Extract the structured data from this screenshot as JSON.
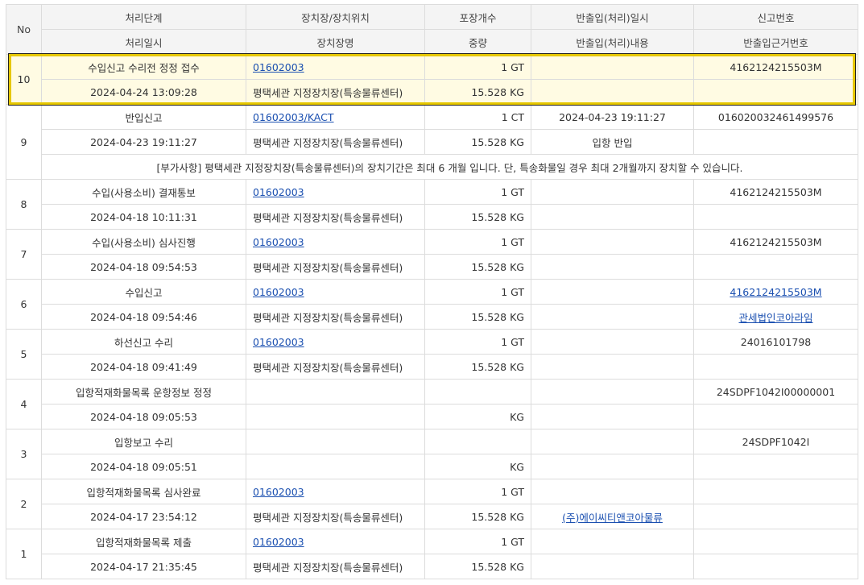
{
  "header": {
    "no": "No",
    "top": [
      "처리단계",
      "장치장/장치위치",
      "포장개수",
      "반출입(처리)일시",
      "신고번호"
    ],
    "bottom": [
      "처리일시",
      "장치장명",
      "중량",
      "반출입(처리)내용",
      "반출입근거번호"
    ]
  },
  "rows": [
    {
      "no": "10",
      "stage": "수입신고 수리전 정정 접수",
      "location": "01602003",
      "count": "1 GT",
      "io_time": "",
      "decl_no": "4162124215503M",
      "time": "2024-04-24 13:09:28",
      "place_name": "평택세관 지정장치장(특송물류센터)",
      "weight": "15.528 KG",
      "io_content": "",
      "basis_no": ""
    },
    {
      "no": "9",
      "stage": "반입신고",
      "location": "01602003/KACT",
      "count": "1 CT",
      "io_time": "2024-04-23 19:11:27",
      "decl_no": "016020032461499576",
      "time": "2024-04-23 19:11:27",
      "place_name": "평택세관 지정장치장(특송물류센터)",
      "weight": "15.528 KG",
      "io_content": "입항 반입",
      "basis_no": ""
    },
    {
      "no": "8",
      "stage": "수입(사용소비) 결재통보",
      "location": "01602003",
      "count": "1 GT",
      "io_time": "",
      "decl_no": "4162124215503M",
      "time": "2024-04-18 10:11:31",
      "place_name": "평택세관 지정장치장(특송물류센터)",
      "weight": "15.528 KG",
      "io_content": "",
      "basis_no": ""
    },
    {
      "no": "7",
      "stage": "수입(사용소비) 심사진행",
      "location": "01602003",
      "count": "1 GT",
      "io_time": "",
      "decl_no": "4162124215503M",
      "time": "2024-04-18 09:54:53",
      "place_name": "평택세관 지정장치장(특송물류센터)",
      "weight": "15.528 KG",
      "io_content": "",
      "basis_no": ""
    },
    {
      "no": "6",
      "stage": "수입신고",
      "location": "01602003",
      "count": "1 GT",
      "io_time": "",
      "decl_no": "4162124215503M",
      "time": "2024-04-18 09:54:46",
      "place_name": "평택세관 지정장치장(특송물류센터)",
      "weight": "15.528 KG",
      "io_content": "",
      "basis_no": "관세법인코아라임"
    },
    {
      "no": "5",
      "stage": "하선신고 수리",
      "location": "01602003",
      "count": "1 GT",
      "io_time": "",
      "decl_no": "24016101798",
      "time": "2024-04-18 09:41:49",
      "place_name": "평택세관 지정장치장(특송물류센터)",
      "weight": "15.528 KG",
      "io_content": "",
      "basis_no": ""
    },
    {
      "no": "4",
      "stage": "입항적재화물목록 운항정보 정정",
      "location": "",
      "count": "",
      "io_time": "",
      "decl_no": "24SDPF1042I00000001",
      "time": "2024-04-18 09:05:53",
      "place_name": "",
      "weight": "KG",
      "io_content": "",
      "basis_no": ""
    },
    {
      "no": "3",
      "stage": "입항보고 수리",
      "location": "",
      "count": "",
      "io_time": "",
      "decl_no": "24SDPF1042I",
      "time": "2024-04-18 09:05:51",
      "place_name": "",
      "weight": "KG",
      "io_content": "",
      "basis_no": ""
    },
    {
      "no": "2",
      "stage": "입항적재화물목록 심사완료",
      "location": "01602003",
      "count": "1 GT",
      "io_time": "",
      "decl_no": "",
      "time": "2024-04-17 23:54:12",
      "place_name": "평택세관 지정장치장(특송물류센터)",
      "weight": "15.528 KG",
      "io_content": "(주)에이씨티앤코아물류",
      "basis_no": ""
    },
    {
      "no": "1",
      "stage": "입항적재화물목록 제출",
      "location": "01602003",
      "count": "1 GT",
      "io_time": "",
      "decl_no": "",
      "time": "2024-04-17 21:35:45",
      "place_name": "평택세관 지정장치장(특송물류센터)",
      "weight": "15.528 KG",
      "io_content": "",
      "basis_no": ""
    }
  ],
  "note": "[부가사항] 평택세관 지정장치장(특송물류센터)의 장치기간은 최대 6 개월 입니다. 단, 특송화물일 경우 최대 2개월까지 장치할 수 있습니다."
}
